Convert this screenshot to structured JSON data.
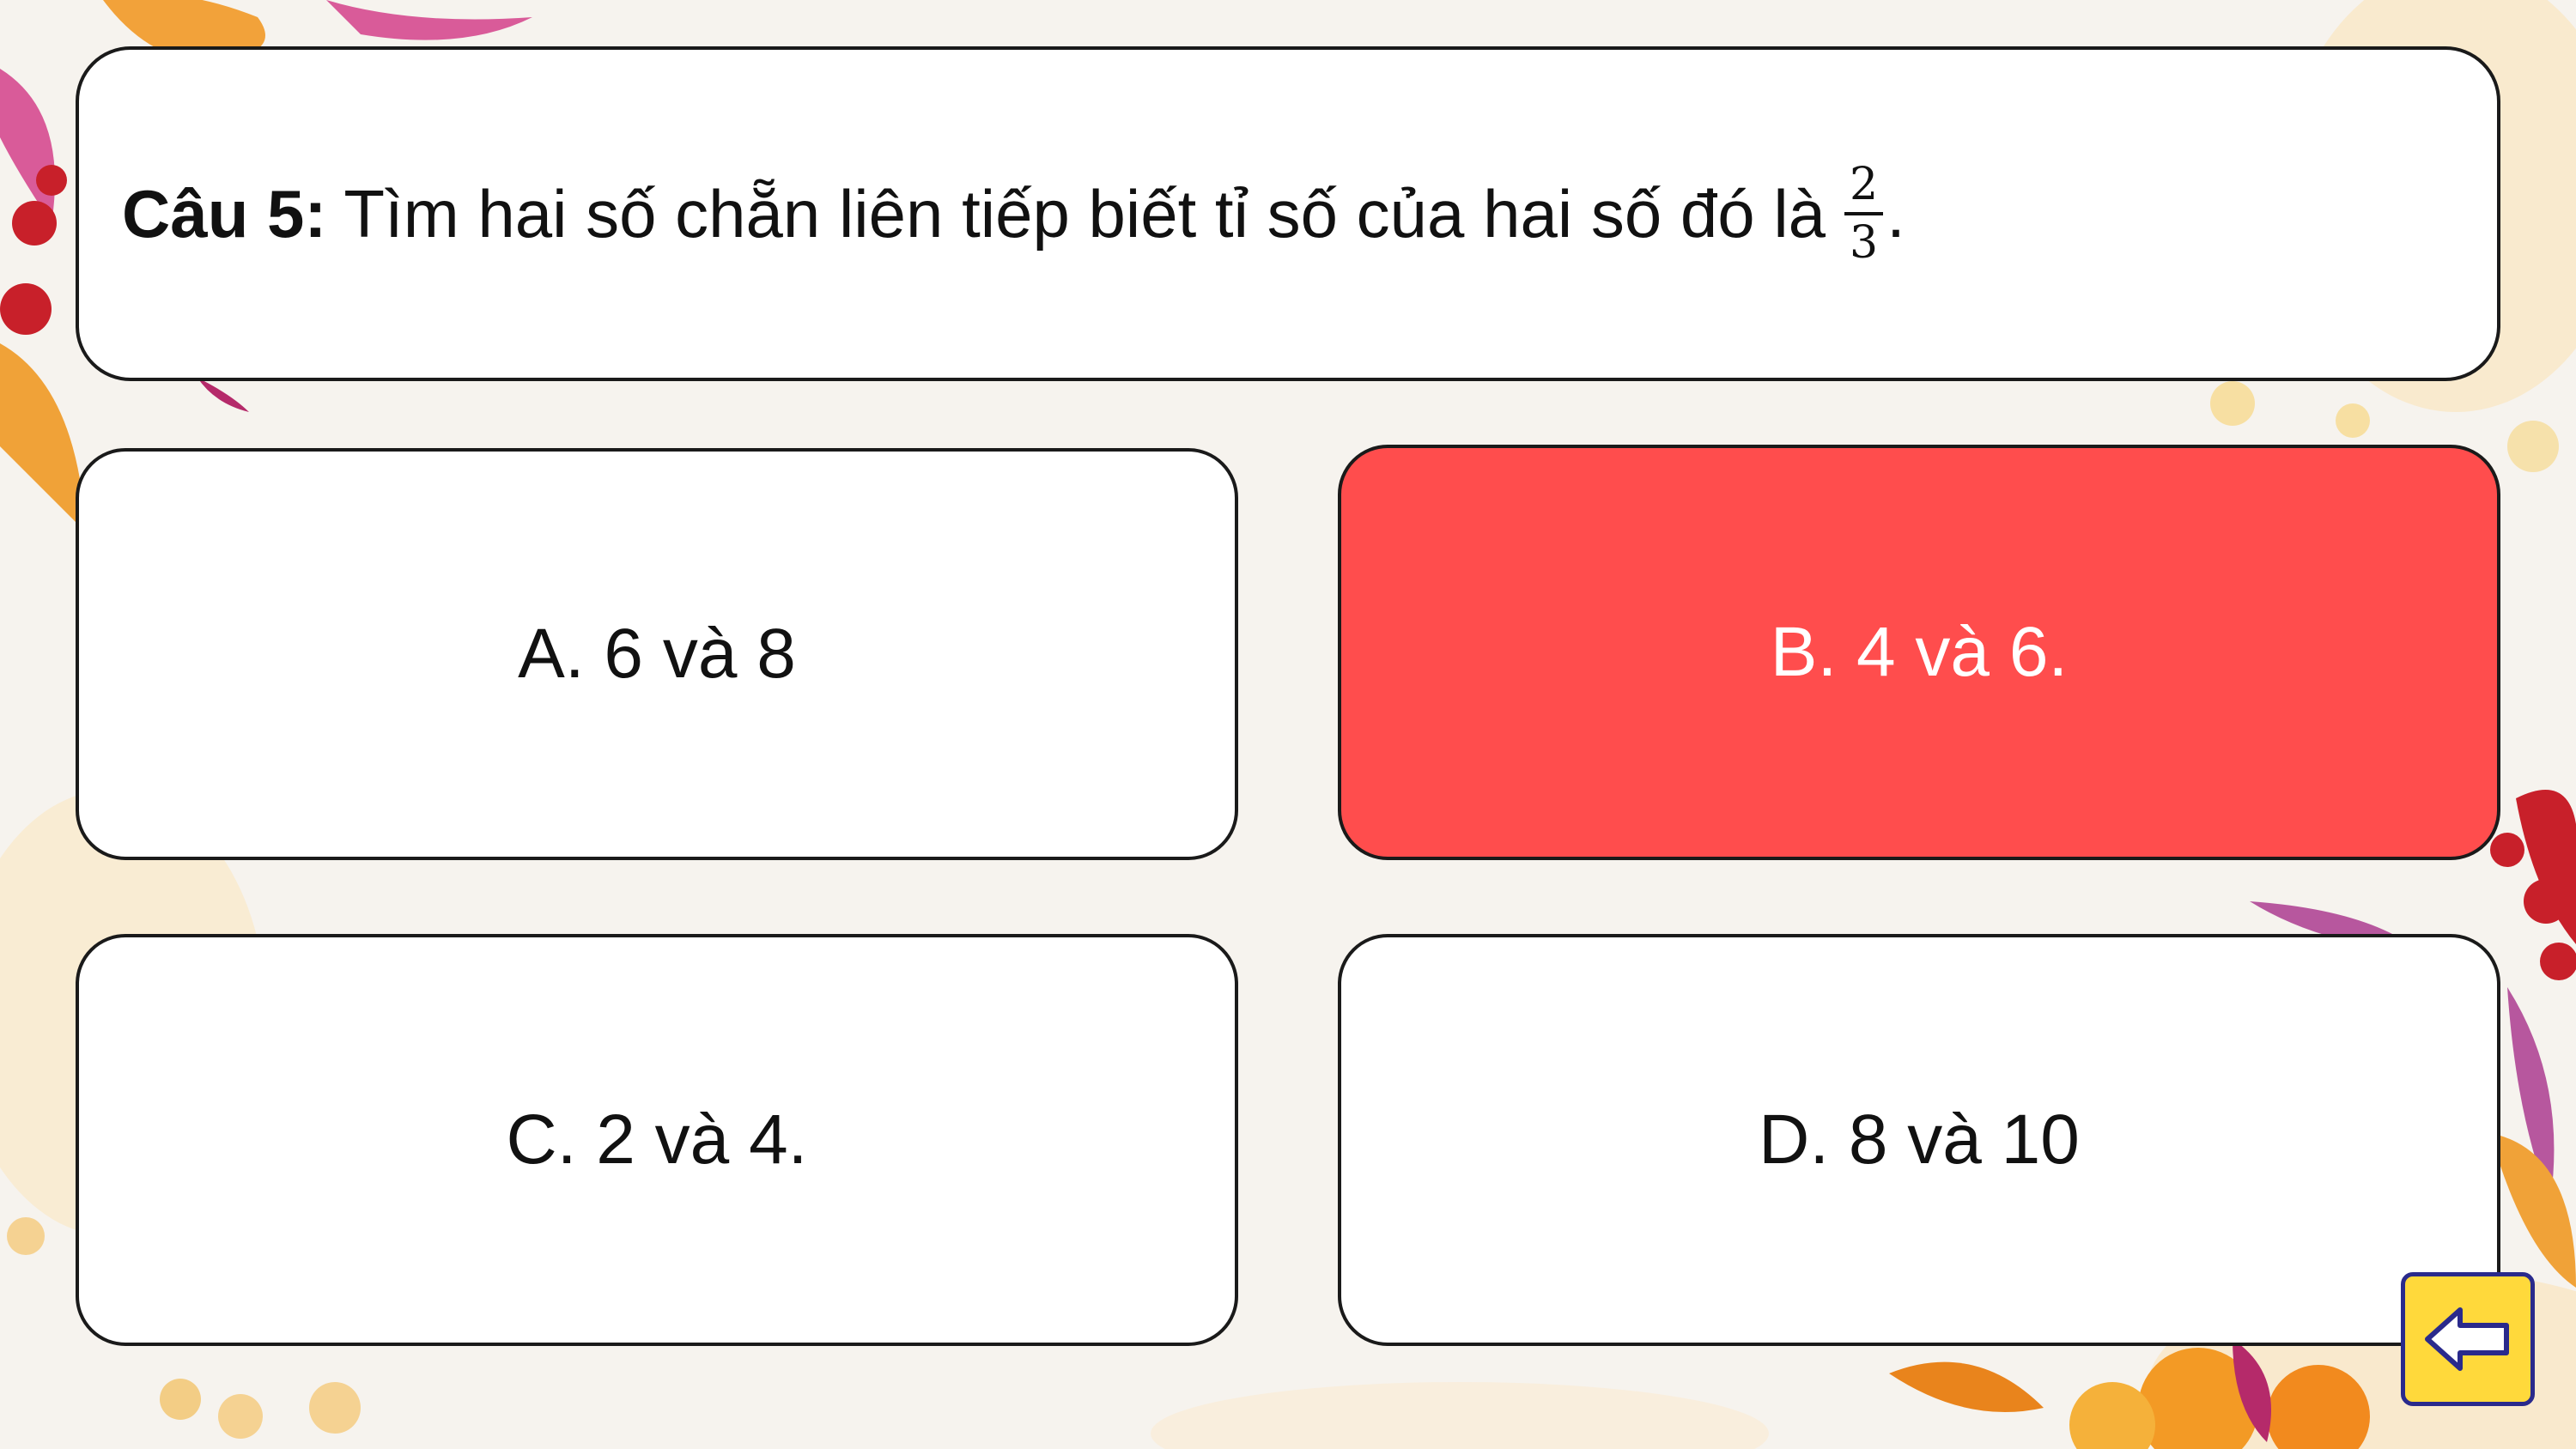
{
  "colors": {
    "background": "#f6f3ee",
    "card_fill": "#ffffff",
    "card_border": "#1a1a1a",
    "selected_fill": "#ff4d4d",
    "back_button_fill": "#ffd93b",
    "back_button_border": "#2a2a8c"
  },
  "question": {
    "label": "Câu 5:",
    "text": "Tìm hai số chẵn liên tiếp biết tỉ số của hai số đó là",
    "fraction_numerator": "2",
    "fraction_denominator": "3",
    "end_punct": "."
  },
  "options": [
    {
      "text": "A. 6 và 8",
      "selected": false
    },
    {
      "text": "B. 4 và 6.",
      "selected": true
    },
    {
      "text": "C. 2 và 4.",
      "selected": false
    },
    {
      "text": "D. 8 và 10",
      "selected": false
    }
  ],
  "back_button": {
    "icon": "back-arrow-icon"
  }
}
